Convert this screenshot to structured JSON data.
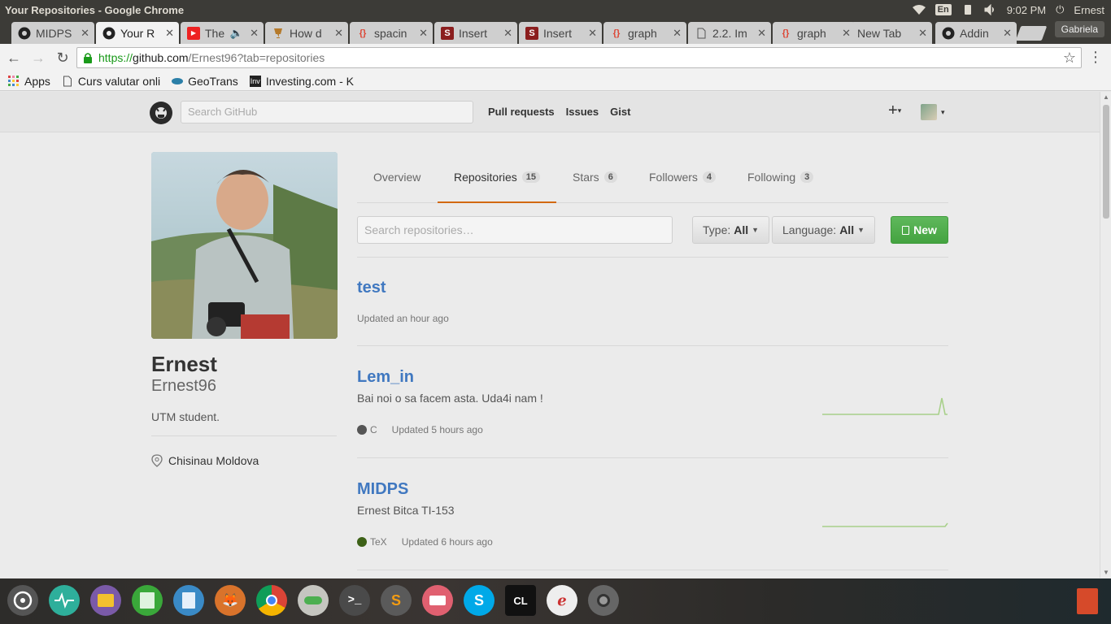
{
  "os": {
    "title": "Your Repositories - Google Chrome",
    "keyboard": "En",
    "time": "9:02 PM",
    "user": "Ernest"
  },
  "tabs": [
    {
      "label": "MIDPS",
      "icon": "github-icon"
    },
    {
      "label": "Your R",
      "icon": "github-icon"
    },
    {
      "label": "The",
      "icon": "youtube-icon"
    },
    {
      "label": "How d",
      "icon": "trophy-icon"
    },
    {
      "label": "spacin",
      "icon": "braces-icon"
    },
    {
      "label": "Insert",
      "icon": "s-icon"
    },
    {
      "label": "Insert",
      "icon": "s-icon"
    },
    {
      "label": "graph",
      "icon": "braces-icon"
    },
    {
      "label": "2.2. Im",
      "icon": "document-icon"
    },
    {
      "label": "graph",
      "icon": "braces-icon"
    },
    {
      "label": "New Tab",
      "icon": ""
    },
    {
      "label": "Addin",
      "icon": "github-icon"
    }
  ],
  "profile_button": "Gabriela",
  "address": {
    "https": "https://",
    "host": "github.com",
    "path": "/Ernest96?tab=repositories"
  },
  "bookmarks": [
    {
      "label": "Apps"
    },
    {
      "label": "Curs valutar onli"
    },
    {
      "label": "GeoTrans"
    },
    {
      "label": "Investing.com - K"
    }
  ],
  "github": {
    "search_placeholder": "Search GitHub",
    "nav": [
      "Pull requests",
      "Issues",
      "Gist"
    ]
  },
  "user": {
    "name": "Ernest",
    "login": "Ernest96",
    "bio": "UTM student.",
    "location": "Chisinau Moldova"
  },
  "user_tabs": [
    {
      "label": "Overview",
      "count": ""
    },
    {
      "label": "Repositories",
      "count": "15"
    },
    {
      "label": "Stars",
      "count": "6"
    },
    {
      "label": "Followers",
      "count": "4"
    },
    {
      "label": "Following",
      "count": "3"
    }
  ],
  "filters": {
    "search_placeholder": "Search repositories…",
    "type_label": "Type:",
    "type_value": "All",
    "language_label": "Language:",
    "language_value": "All",
    "new_label": "New"
  },
  "repos": [
    {
      "name": "test",
      "description": "",
      "language": "",
      "language_color": "",
      "updated": "Updated an hour ago",
      "spark": "none"
    },
    {
      "name": "Lem_in",
      "description": "Bai noi o sa facem asta. Uda4i nam !",
      "language": "C",
      "language_color": "#555555",
      "updated": "Updated 5 hours ago",
      "spark": "spike"
    },
    {
      "name": "MIDPS",
      "description": "Ernest Bitca TI-153",
      "language": "TeX",
      "language_color": "#3D6117",
      "updated": "Updated 6 hours ago",
      "spark": "flat"
    }
  ],
  "colors": {
    "link": "#4078c0",
    "accent_tab": "#d26911",
    "new_button": "#55a532",
    "sparkline": "#a8d08a"
  }
}
